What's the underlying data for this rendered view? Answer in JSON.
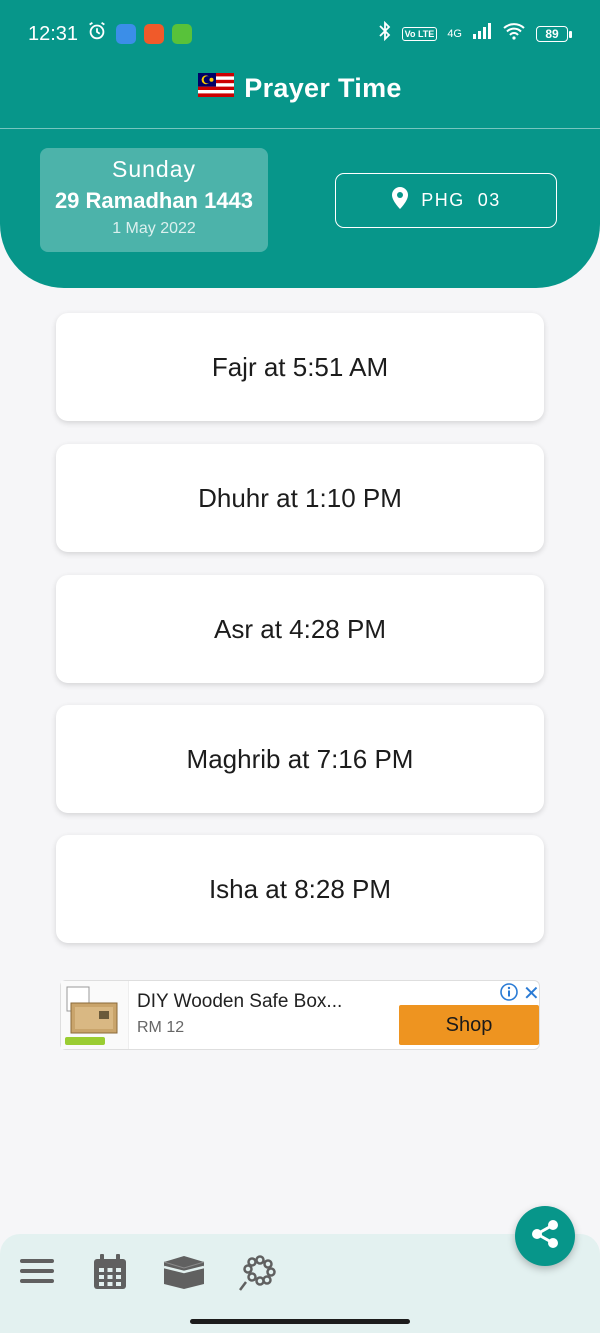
{
  "status_bar": {
    "time": "12:31",
    "network": "4G",
    "battery": "89"
  },
  "app": {
    "title": "Prayer Time",
    "flag_icon": "malaysia-flag-icon",
    "accent_color": "#07968a"
  },
  "date": {
    "day": "Sunday",
    "hijri": "29 Ramadhan 1443",
    "gregorian": "1 May 2022"
  },
  "zone": {
    "label": "PHG  03",
    "icon": "location-pin-icon"
  },
  "prayers": [
    {
      "text": "Fajr at 5:51 AM"
    },
    {
      "text": "Dhuhr at 1:10 PM"
    },
    {
      "text": "Asr at 4:28 PM"
    },
    {
      "text": "Maghrib at 7:16 PM"
    },
    {
      "text": "Isha at 8:28 PM"
    }
  ],
  "ad": {
    "title": "DIY Wooden Safe Box...",
    "price": "RM 12",
    "cta": "Shop",
    "cta_color": "#ee9420"
  },
  "bottom_nav": {
    "items": [
      "menu-icon",
      "calendar-icon",
      "kaaba-icon",
      "tasbih-icon"
    ],
    "fab_icon": "share-icon"
  }
}
